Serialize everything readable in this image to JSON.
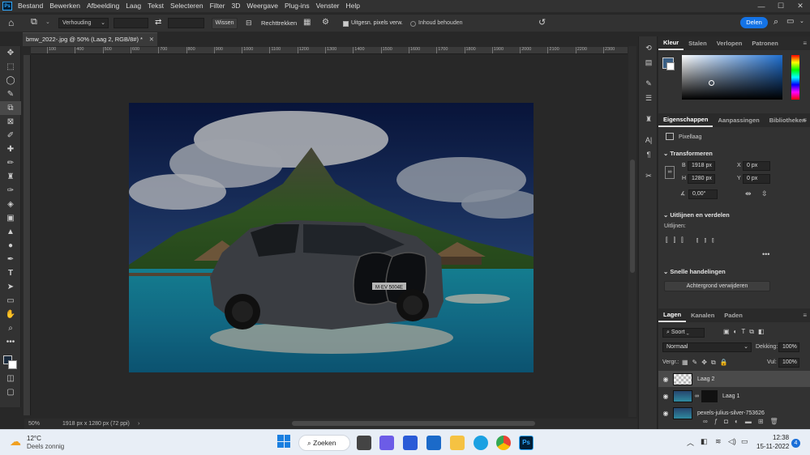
{
  "menubar": {
    "items": [
      "Bestand",
      "Bewerken",
      "Afbeelding",
      "Laag",
      "Tekst",
      "Selecteren",
      "Filter",
      "3D",
      "Weergave",
      "Plug-ins",
      "Venster",
      "Help"
    ],
    "window_controls": [
      "—",
      "☐",
      "✕"
    ]
  },
  "options": {
    "ratio": "Verhouding",
    "clear_label": "Wissen",
    "straighten_label": "Rechttrekken",
    "delete_cropped": "Uitgesn. pixels verw.",
    "content_aware": "Inhoud behouden",
    "share_label": "Delen"
  },
  "document": {
    "tab_title": "bmw_2022-.jpg @ 50% (Laag 2, RGB/8#) *",
    "zoom": "50%",
    "doc_info": "1918 px x 1280 px (72 ppi)",
    "plate": "M·EV 5004E"
  },
  "ruler": {
    "top_ticks": [
      "100",
      "400",
      "500",
      "600",
      "700",
      "800",
      "900",
      "1000",
      "1100",
      "1200",
      "1300",
      "1400",
      "1500",
      "1600",
      "1700",
      "1800",
      "1900",
      "2000",
      "2100",
      "2200",
      "2300"
    ]
  },
  "panels": {
    "color_tabs": [
      "Kleur",
      "Stalen",
      "Verlopen",
      "Patronen"
    ],
    "prop_tabs": [
      "Eigenschappen",
      "Aanpassingen",
      "Bibliotheken"
    ],
    "pixel_layer": "Pixellaag",
    "transform": {
      "title": "Transformeren",
      "w_label": "B",
      "w_value": "1918 px",
      "h_label": "H",
      "h_value": "1280 px",
      "x_label": "X",
      "x_value": "0 px",
      "y_label": "Y",
      "y_value": "0 px",
      "angle": "0,00°"
    },
    "align": {
      "title": "Uitlijnen en verdelen",
      "sub": "Uitlijnen:"
    },
    "quick": {
      "title": "Snelle handelingen",
      "remove_bg": "Achtergrond verwijderen"
    },
    "layer_tabs": [
      "Lagen",
      "Kanalen",
      "Paden"
    ],
    "layer_filter": "Soort",
    "blend_mode": "Normaal",
    "opacity_label": "Dekking:",
    "opacity_value": "100%",
    "lock_label": "Vergr.:",
    "fill_label": "Vul:",
    "fill_value": "100%",
    "layers": [
      {
        "name": "Laag 2"
      },
      {
        "name": "Laag 1"
      },
      {
        "name": "pexels-julius-silver-753626"
      }
    ]
  },
  "taskbar": {
    "temp": "12°C",
    "weather": "Deels zonnig",
    "search": "Zoeken",
    "time": "12:38",
    "date": "15-11-2022",
    "notif": "4"
  },
  "colors": {
    "accent": "#1473e6",
    "ps_blue": "#31a8ff",
    "panel_bg": "#323232"
  }
}
